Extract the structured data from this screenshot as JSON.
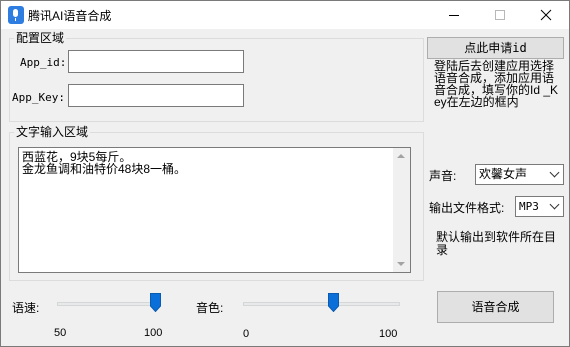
{
  "window": {
    "title": "腾讯AI语音合成",
    "icon": "microphone-icon"
  },
  "config": {
    "legend": "配置区域",
    "app_id_label": "App_id:",
    "app_id_value": "",
    "app_key_label": "App_Key:",
    "app_key_value": ""
  },
  "apply_button_label": "点此申请id",
  "apply_hint": "登陆后去创建应用选择语音合成，添加应用语音合成，填写你的Id _Key在左边的框内",
  "text_input": {
    "legend": "文字输入区域",
    "content": "西蓝花，9块5每斤。\n金龙鱼调和油特价48块8一桶。"
  },
  "voice": {
    "label": "声音:",
    "selected": "欢馨女声"
  },
  "format": {
    "label": "输出文件格式:",
    "selected": "MP3"
  },
  "output_hint": "默认输出到软件所在目录",
  "speed": {
    "label": "语速:",
    "min_label": "50",
    "max_label": "100",
    "min": 50,
    "max": 100,
    "value": 100
  },
  "tone": {
    "label": "音色:",
    "min_label": "0",
    "max_label": "100",
    "min": 0,
    "max": 100,
    "value": 58
  },
  "synth_button_label": "语音合成",
  "colors": {
    "thumb": "#0a6fd8",
    "accent": "#2e7de0"
  }
}
